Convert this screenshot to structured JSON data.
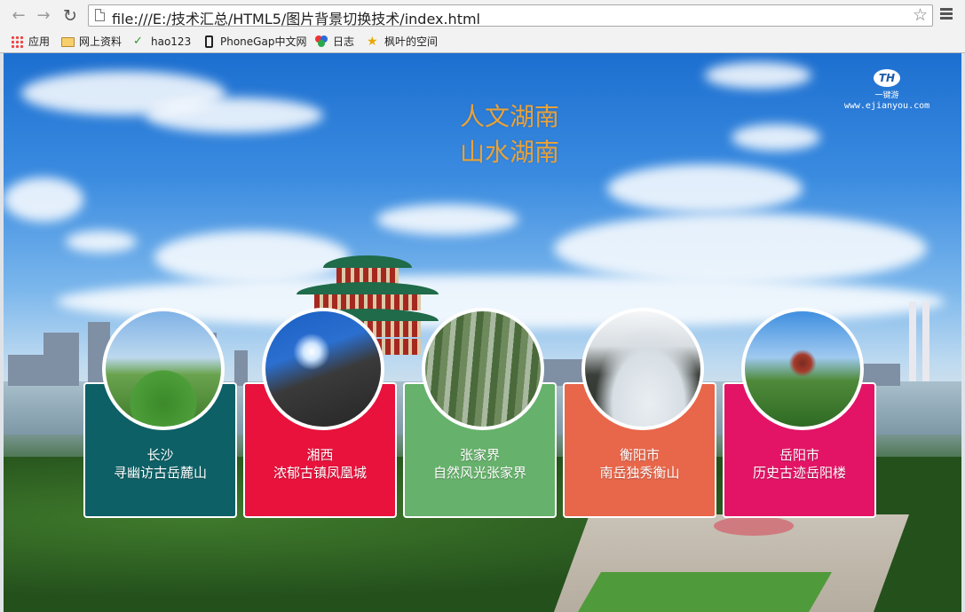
{
  "browser": {
    "url": "file:///E:/技术汇总/HTML5/图片背景切换技术/index.html",
    "bookmarks": [
      {
        "label": "应用",
        "icon": "apps-grid-icon"
      },
      {
        "label": "网上资料",
        "icon": "folder-icon"
      },
      {
        "label": "hao123",
        "icon": "hao123-icon"
      },
      {
        "label": "PhoneGap中文网",
        "icon": "phone-icon"
      },
      {
        "label": "日志",
        "icon": "rings-icon"
      },
      {
        "label": "枫叶的空间",
        "icon": "qzone-star-icon"
      }
    ]
  },
  "page": {
    "logo": {
      "mark": "TH",
      "name": "一键游",
      "url": "www.ejianyou.com"
    },
    "headline": {
      "line1": "人文湖南",
      "line2": "山水湖南"
    },
    "cards": [
      {
        "title": "长沙",
        "subtitle": "寻幽访古岳麓山",
        "color": "#0d6066"
      },
      {
        "title": "湘西",
        "subtitle": "浓郁古镇凤凰城",
        "color": "#e8123c"
      },
      {
        "title": "张家界",
        "subtitle": "自然风光张家界",
        "color": "#66b16b"
      },
      {
        "title": "衡阳市",
        "subtitle": "南岳独秀衡山",
        "color": "#e8664a"
      },
      {
        "title": "岳阳市",
        "subtitle": "历史古迹岳阳楼",
        "color": "#e31466"
      }
    ]
  }
}
